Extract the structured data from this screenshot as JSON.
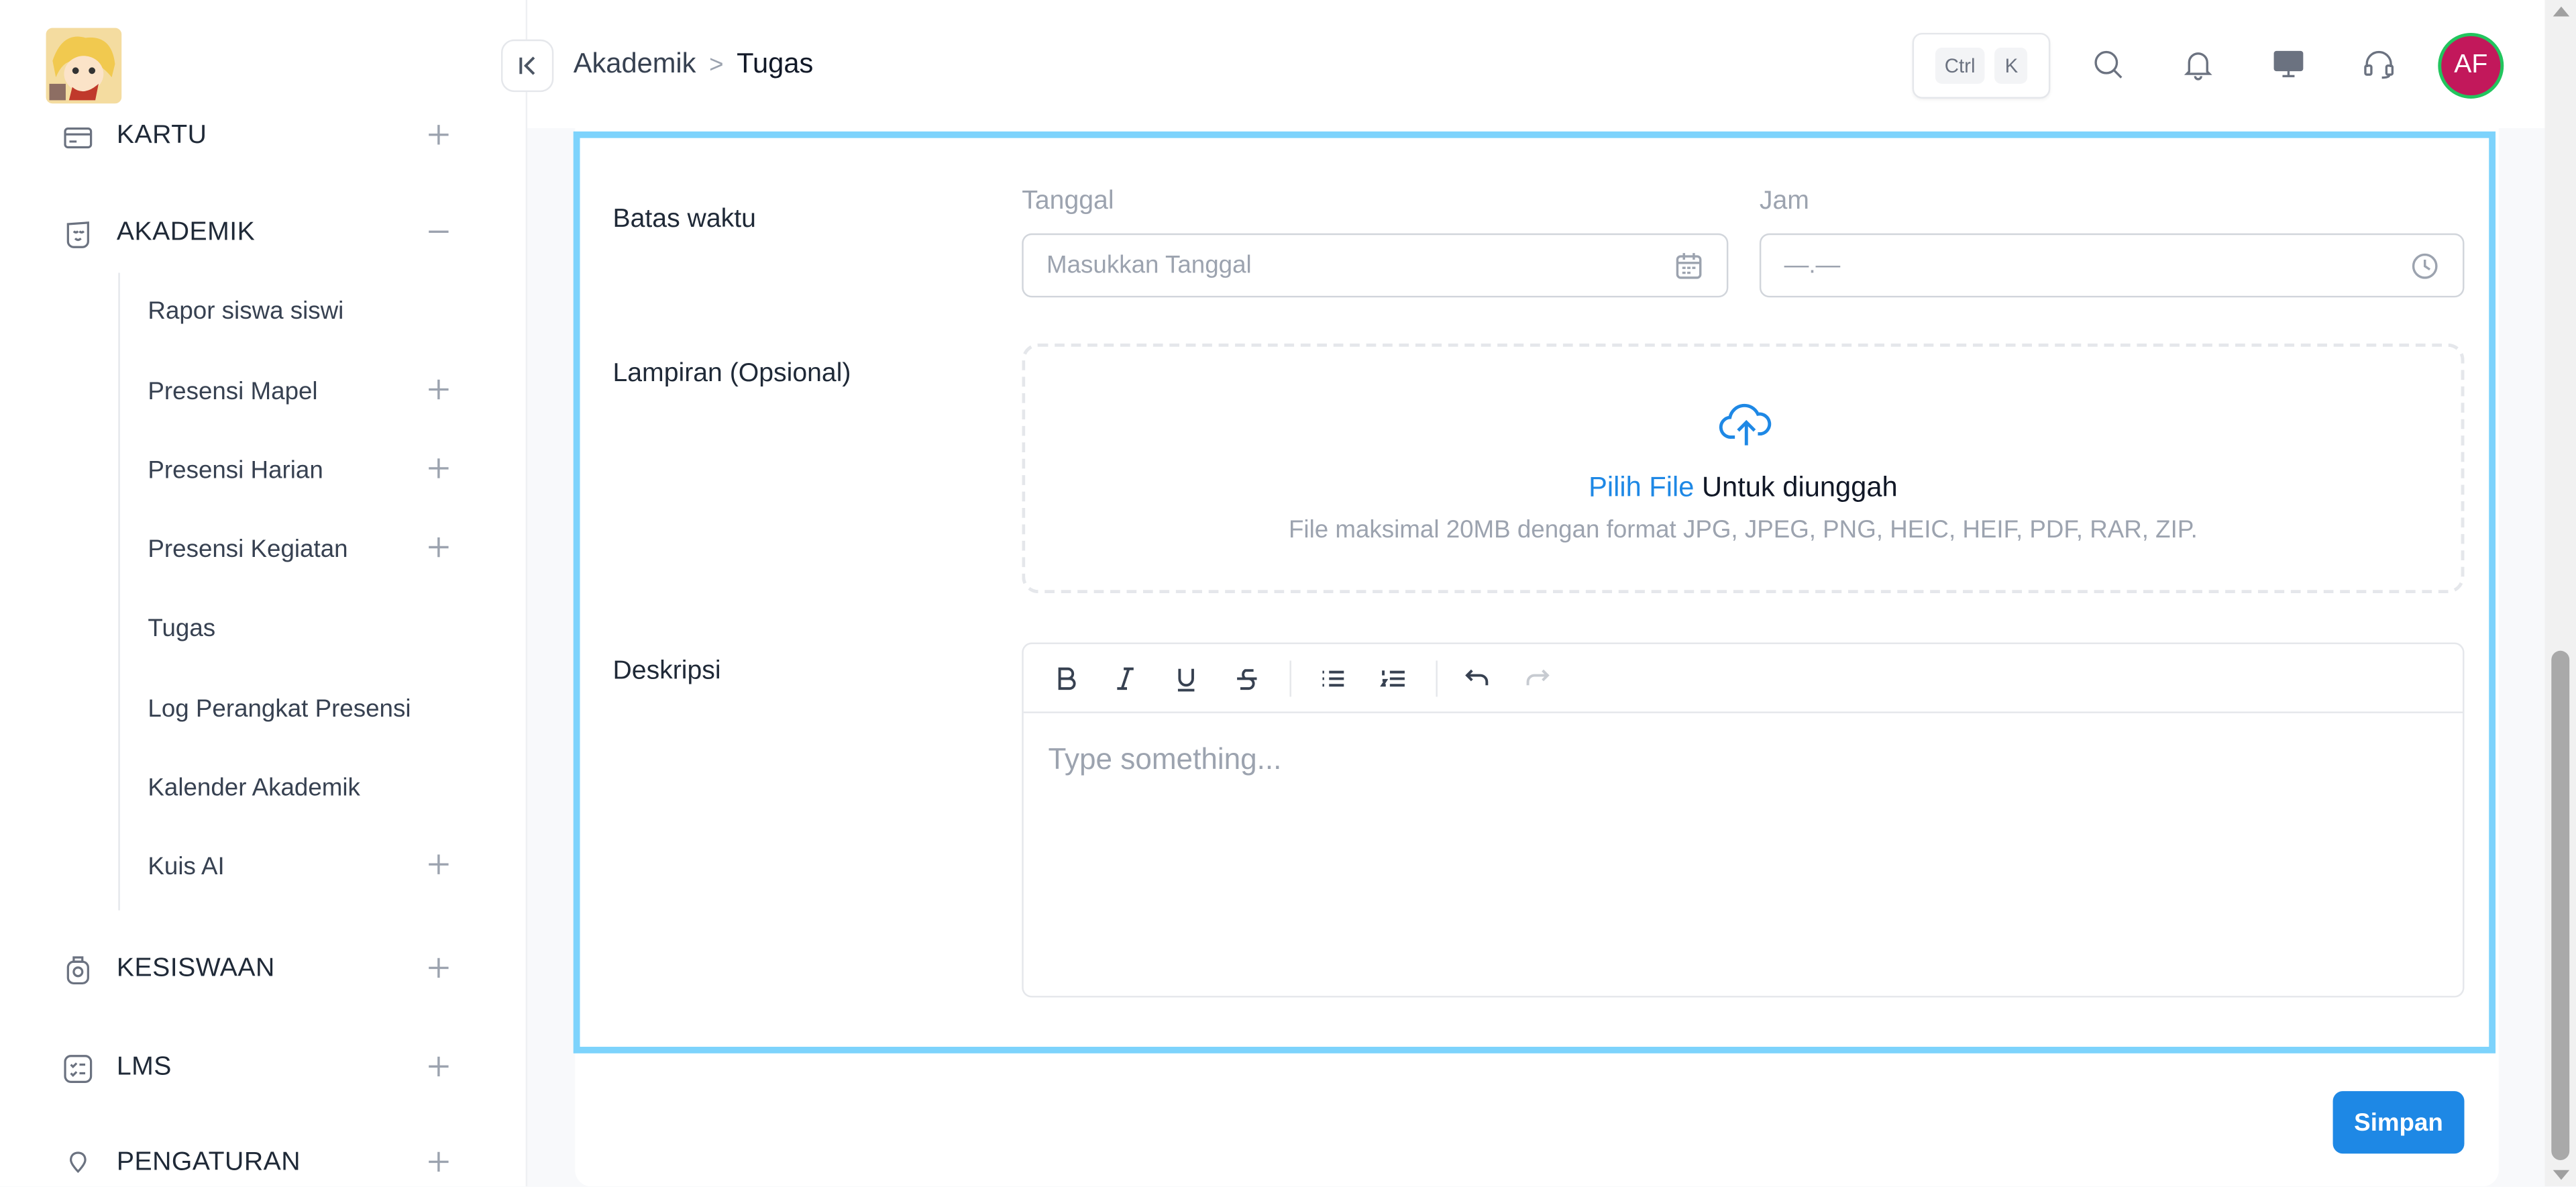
{
  "breadcrumb": {
    "parent": "Akademik",
    "separator": ">",
    "current": "Tugas"
  },
  "shortcut": {
    "key1": "Ctrl",
    "key2": "K"
  },
  "user": {
    "initials": "AF",
    "avatar_color": "#c2185b"
  },
  "sidebar": {
    "items": [
      {
        "label": "KARTU",
        "icon": "card-icon",
        "expanded": false
      },
      {
        "label": "AKADEMIK",
        "icon": "academic-icon",
        "expanded": true
      },
      {
        "label": "KESISWAAN",
        "icon": "student-icon",
        "expanded": false
      },
      {
        "label": "LMS",
        "icon": "checklist-icon",
        "expanded": false
      },
      {
        "label": "PENGATURAN",
        "icon": "settings-icon",
        "expanded": false
      }
    ],
    "sub_items": [
      {
        "label": "Rapor siswa siswi",
        "expandable": false
      },
      {
        "label": "Presensi Mapel",
        "expandable": true
      },
      {
        "label": "Presensi Harian",
        "expandable": true
      },
      {
        "label": "Presensi Kegiatan",
        "expandable": true
      },
      {
        "label": "Tugas",
        "expandable": false
      },
      {
        "label": "Log Perangkat Presensi",
        "expandable": false
      },
      {
        "label": "Kalender Akademik",
        "expandable": false
      },
      {
        "label": "Kuis AI",
        "expandable": true
      }
    ]
  },
  "form": {
    "deadline_label": "Batas waktu",
    "date_label": "Tanggal",
    "date_placeholder": "Masukkan Tanggal",
    "time_label": "Jam",
    "time_placeholder": "—.—",
    "attachment_label": "Lampiran (Opsional)",
    "upload_pick": "Pilih File",
    "upload_rest": " Untuk diunggah",
    "upload_hint": "File maksimal 20MB dengan format JPG, JPEG, PNG, HEIC, HEIF, PDF, RAR, ZIP.",
    "description_label": "Deskripsi",
    "editor_placeholder": "Type something...",
    "save_label": "Simpan"
  },
  "colors": {
    "accent": "#1e88e5",
    "focus_border": "#7dd3fc"
  }
}
